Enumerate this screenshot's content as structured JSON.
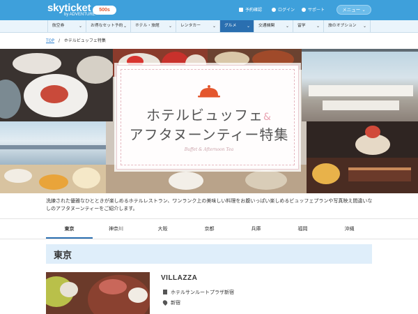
{
  "header": {
    "logo_main": "skyticket",
    "logo_sub": "by ADVENTURE",
    "badge": "500s",
    "links": {
      "reservations": "予約確認",
      "login": "ログイン",
      "support": "サポート"
    },
    "menu_label": "メニュー"
  },
  "nav": {
    "items": [
      {
        "label": "航空券"
      },
      {
        "label": "お得なセット予約"
      },
      {
        "label": "ホテル・旅館"
      },
      {
        "label": "レンタカー"
      },
      {
        "label": "グルメ"
      },
      {
        "label": "交通機関"
      },
      {
        "label": "留学"
      },
      {
        "label": "旅のオプション"
      }
    ],
    "active_index": 4
  },
  "breadcrumb": {
    "top": "TOP",
    "separator": "/",
    "current": "ホテルビュッフェ特集"
  },
  "hero": {
    "title_line1": "ホテルビュッフェ",
    "title_amp": "&",
    "title_line2": "アフタヌーンティー特集",
    "script_text": "Buffet & Afternoon Tea"
  },
  "intro_text": "洗練された優雅なひとときが楽しめるホテルレストラン、ワンランク上の美味しい料理をお腹いっぱい楽しめるビュッフェプランや写真映え間違いなしのアフタヌーンティーをご紹介します。",
  "tabs": {
    "items": [
      "東京",
      "神奈川",
      "大阪",
      "京都",
      "兵庫",
      "福岡",
      "沖縄"
    ],
    "active_index": 0
  },
  "section": {
    "heading": "東京"
  },
  "restaurant": {
    "name": "VILLAZZA",
    "hotel": "ホテルサンルートプラザ新宿",
    "area": "新宿"
  },
  "colors": {
    "topbar": "#3ea0db",
    "nav_active": "#2a6fb0",
    "section_bg": "#dfeefa",
    "accent_pink": "#e9a3b2"
  }
}
